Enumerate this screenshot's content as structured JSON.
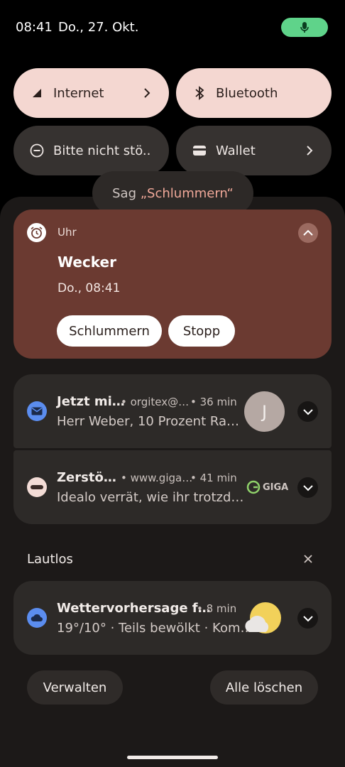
{
  "status_bar": {
    "time": "08:41",
    "date": "Do., 27. Okt.",
    "mic_icon": "microphone-icon",
    "mic_color": "#5fd38a"
  },
  "quick_settings": {
    "tiles": [
      {
        "label": "Internet",
        "icon": "signal-icon",
        "state": "active",
        "has_chevron": true
      },
      {
        "label": "Bluetooth",
        "icon": "bluetooth-icon",
        "state": "active",
        "has_chevron": false
      },
      {
        "label": "Bitte nicht stö..",
        "icon": "do-not-disturb-icon",
        "state": "inactive",
        "has_chevron": false
      },
      {
        "label": "Wallet",
        "icon": "wallet-icon",
        "state": "inactive",
        "has_chevron": true
      }
    ]
  },
  "hint": {
    "prefix": "Sag ",
    "accent": "„Schlummern“",
    "accent_color": "#f0a899"
  },
  "alarm": {
    "app_name": "Uhr",
    "title": "Wecker",
    "time": "Do., 08:41",
    "snooze_label": "Schlummern",
    "stop_label": "Stopp",
    "card_color": "#6b3a31"
  },
  "notifications": [
    {
      "app_icon": "mail-icon",
      "title": "Jetzt mi…",
      "source": "• orgitex@…",
      "age": "• 36 min",
      "body": "Herr Weber, 10 Prozent Ra…",
      "avatar_letter": "J"
    },
    {
      "app_icon": "giga-icon",
      "title": "Zerstö…",
      "source": "• www.giga…",
      "age": "• 41 min",
      "body": "Idealo verrät, wie ihr trotzd…",
      "logo_text": "GIGA"
    }
  ],
  "silent_section": {
    "label": "Lautlos",
    "close_icon": "close-icon"
  },
  "weather_notification": {
    "app_icon": "cloud-icon",
    "title": "Wettervorhersage f…",
    "age": "• 8 min",
    "body": "19°/10° · Teils bewölkt · Kom…",
    "image_icon": "partly-cloudy-icon"
  },
  "footer": {
    "manage_label": "Verwalten",
    "clear_all_label": "Alle löschen"
  }
}
